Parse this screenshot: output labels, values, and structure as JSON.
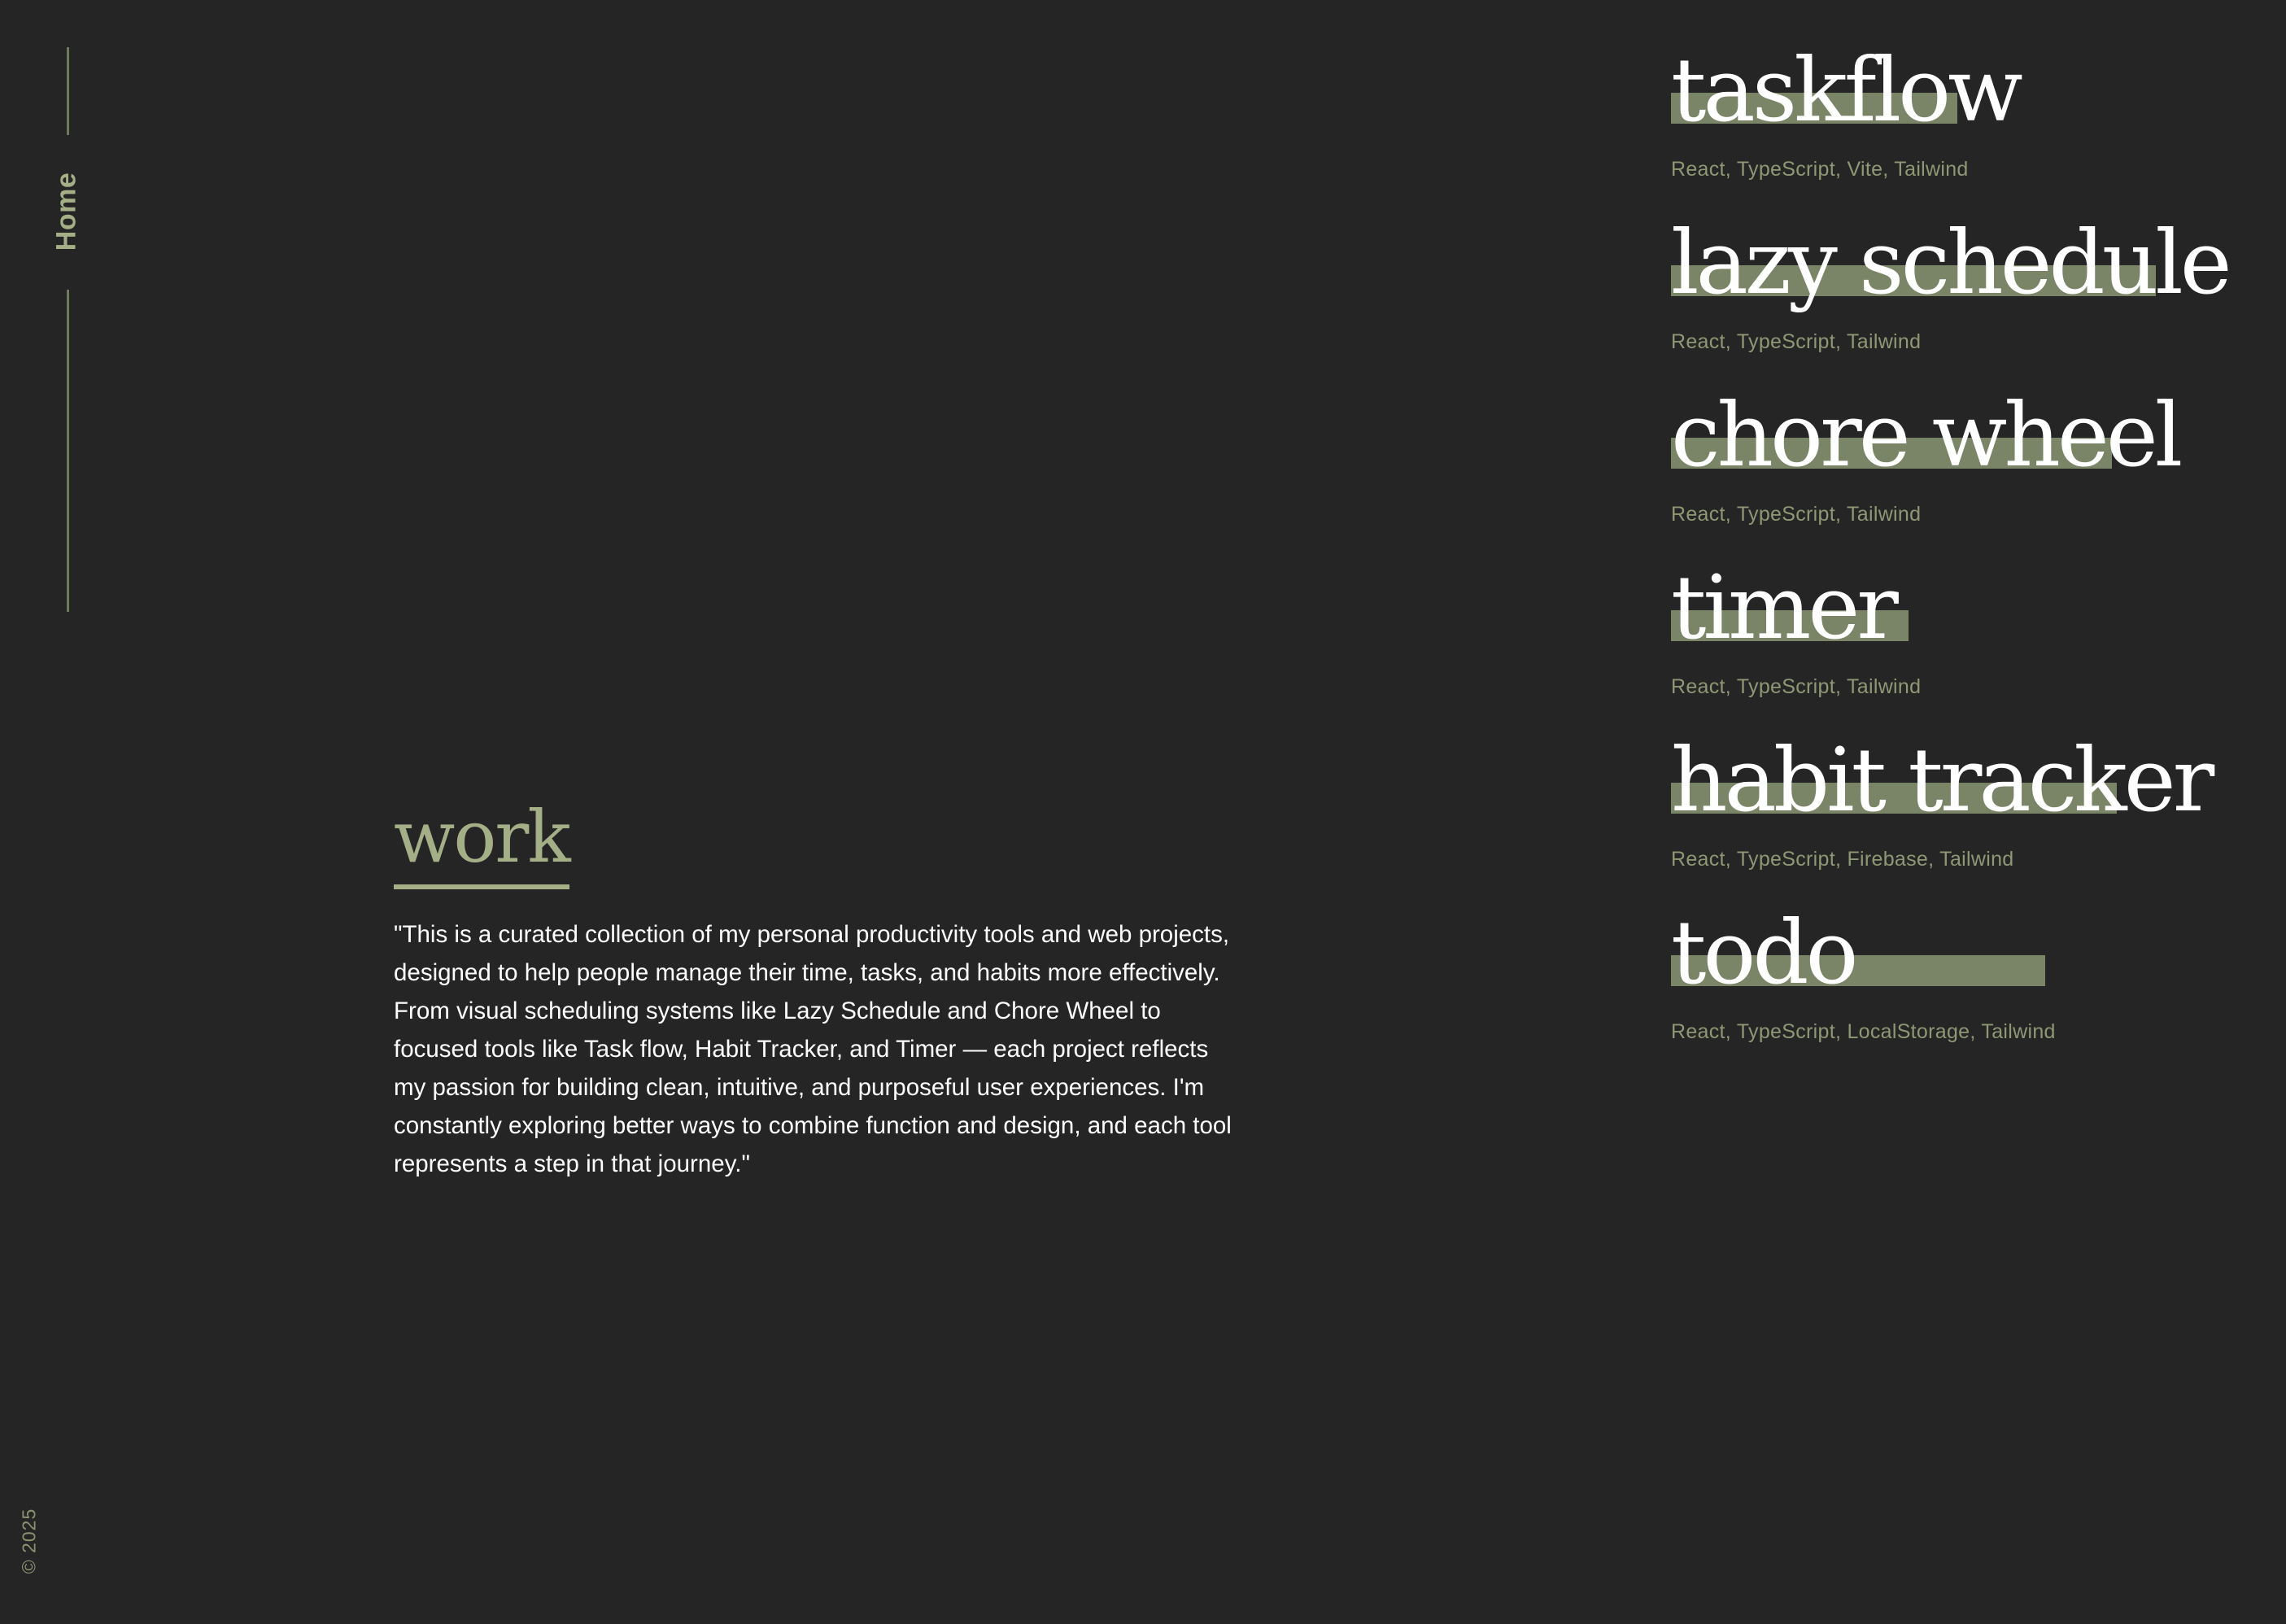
{
  "sidebar": {
    "home_label": "Home",
    "copyright": "© 2025"
  },
  "work": {
    "heading": "work",
    "description": "\"This is a curated collection of my personal productivity tools and web projects, designed to help people manage their time, tasks, and habits more effectively. From visual scheduling systems like Lazy Schedule and Chore Wheel to focused tools like Task flow, Habit Tracker, and Timer — each project reflects my passion for building clean, intuitive, and purposeful user experiences. I'm constantly exploring better ways to combine function and design, and each tool represents a step in that journey.\""
  },
  "projects": [
    {
      "title": "taskflow",
      "tech": "React, TypeScript, Vite, Tailwind"
    },
    {
      "title": "lazy schedule",
      "tech": "React, TypeScript, Tailwind"
    },
    {
      "title": "chore wheel",
      "tech": "React, TypeScript, Tailwind"
    },
    {
      "title": "timer",
      "tech": "React, TypeScript, Tailwind"
    },
    {
      "title": "habit tracker",
      "tech": "React, TypeScript, Firebase, Tailwind"
    },
    {
      "title": "todo",
      "tech": "React, TypeScript, LocalStorage, Tailwind"
    }
  ],
  "colors": {
    "background": "#252525",
    "accent": "#a4ae87",
    "highlight": "#7a8466",
    "muted": "#8e9875",
    "text": "#ffffff"
  }
}
